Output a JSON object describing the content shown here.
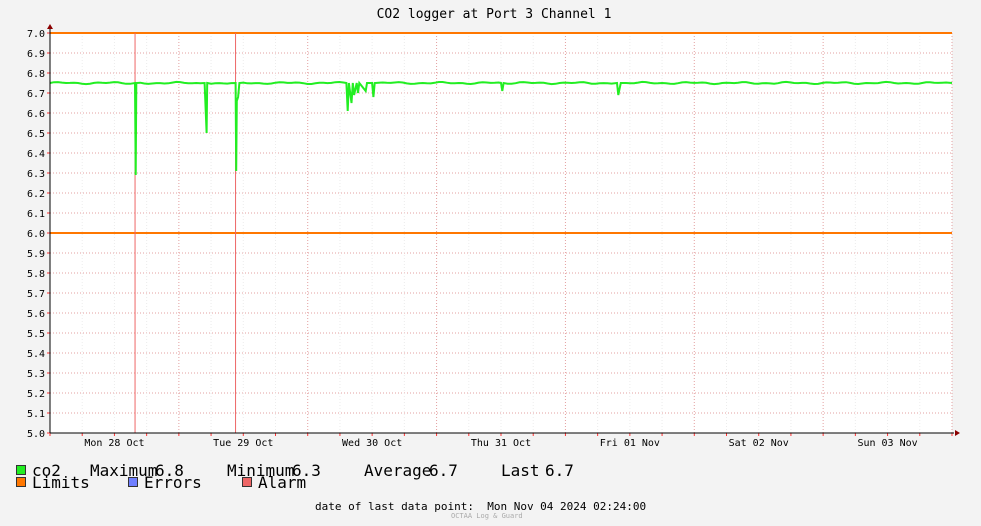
{
  "chart_data": {
    "type": "line",
    "title": "CO2 logger at Port 3 Channel 1",
    "ylim": [
      5.0,
      7.0
    ],
    "y_ticks": [
      "7.0",
      "6.9",
      "6.8",
      "6.7",
      "6.6",
      "6.5",
      "6.4",
      "6.3",
      "6.2",
      "6.1",
      "6.0",
      "5.9",
      "5.8",
      "5.7",
      "5.6",
      "5.5",
      "5.4",
      "5.3",
      "5.2",
      "5.1",
      "5.0"
    ],
    "x_range_days": [
      0,
      7
    ],
    "x_tick_labels": [
      "Mon 28 Oct",
      "Tue 29 Oct",
      "Wed 30 Oct",
      "Thu 31 Oct",
      "Fri 01 Nov",
      "Sat 02 Nov",
      "Sun 03 Nov"
    ],
    "x_tick_positions_days": [
      0.5,
      1.5,
      2.5,
      3.5,
      4.5,
      5.5,
      6.5
    ],
    "grid": true,
    "limits": [
      6.0,
      7.0
    ],
    "alarm_markers_days": [
      0.66,
      1.44
    ],
    "series": [
      {
        "name": "co2",
        "color": "#22ee22",
        "baseline": 6.75,
        "x_days": [
          0.0,
          0.66,
          0.665,
          0.67,
          1.2,
          1.215,
          1.22,
          1.44,
          1.445,
          1.45,
          1.46,
          1.47,
          2.3,
          2.31,
          2.32,
          2.34,
          2.35,
          2.36,
          2.38,
          2.39,
          2.4,
          2.45,
          2.46,
          2.47,
          2.5,
          2.51,
          2.52,
          3.5,
          3.51,
          3.52,
          4.4,
          4.41,
          4.42,
          4.43,
          4.44,
          7.0
        ],
        "values": [
          6.75,
          6.75,
          6.29,
          6.75,
          6.75,
          6.5,
          6.75,
          6.75,
          6.31,
          6.66,
          6.68,
          6.75,
          6.75,
          6.61,
          6.75,
          6.65,
          6.75,
          6.69,
          6.75,
          6.7,
          6.75,
          6.71,
          6.75,
          6.75,
          6.75,
          6.68,
          6.75,
          6.75,
          6.71,
          6.75,
          6.75,
          6.69,
          6.72,
          6.75,
          6.75,
          6.75
        ]
      }
    ]
  },
  "legend": {
    "series_name": "co2",
    "maximum_label": "Maximum",
    "maximum_value": "6.8",
    "minimum_label": "Minimum",
    "minimum_value": "6.3",
    "average_label": "Average",
    "average_value": "6.7",
    "last_label": "Last",
    "last_value": "6.7",
    "limits_label": "Limits",
    "errors_label": "Errors",
    "alarm_label": "Alarm",
    "colors": {
      "co2": "#22ee22",
      "limits": "#ff7700",
      "errors": "#6f7fff",
      "alarm": "#ee6666"
    }
  },
  "footer": {
    "last_point_label": "date of last data point:",
    "last_point_value": "Mon Nov 04 2024 02:24:00",
    "credit": "OCTAA Log & Guard"
  }
}
